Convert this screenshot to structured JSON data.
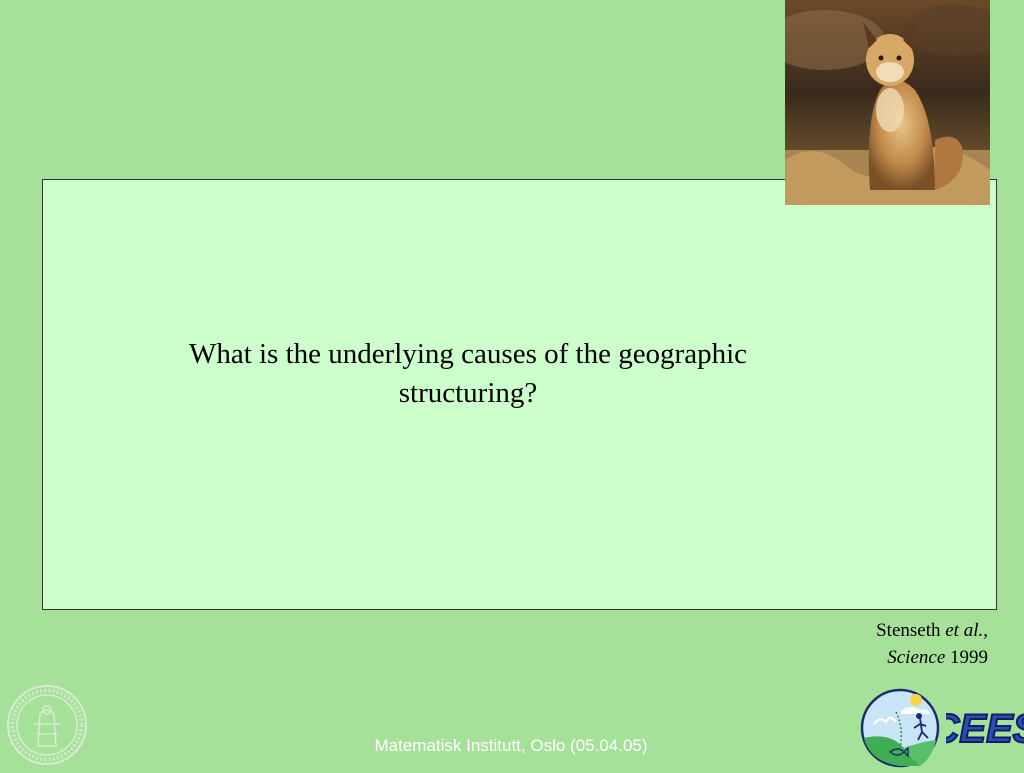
{
  "slide": {
    "question": "What is the underlying causes of the geographic structuring?",
    "citation": {
      "author": "Stenseth",
      "etal": "et al.",
      "comma": ",",
      "journal": "Science",
      "year": "1999"
    },
    "footer": "Matematisk Institutt, Oslo (05.04.05)",
    "logo_text": "CEES"
  },
  "colors": {
    "background": "#a6e19a",
    "textbox": "#ccffcc",
    "logo_blue": "#2a4fb0"
  },
  "icons": {
    "photo": "lynx-photo",
    "seal": "university-seal-icon",
    "logo": "cees-logo-icon"
  }
}
